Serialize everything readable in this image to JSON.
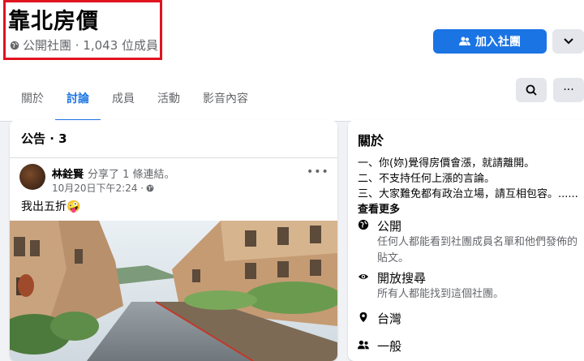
{
  "group": {
    "title": "靠北房價",
    "meta": "公開社團 · 1,043 位成員",
    "join_label": "加入社團",
    "accent_color": "#1b74e4",
    "highlight_color": "#e0131f"
  },
  "tabs": [
    {
      "label": "關於"
    },
    {
      "label": "討論"
    },
    {
      "label": "成員"
    },
    {
      "label": "活動"
    },
    {
      "label": "影音內容"
    }
  ],
  "announcements": {
    "title": "公告 · 3",
    "post": {
      "author": "林銓賢",
      "action": "分享了 1 條連結。",
      "time": "10月20日下午2:24 ·",
      "text": "我出五折🤪"
    }
  },
  "about": {
    "title": "關於",
    "description": "一、你(妳)覺得房價會漲，就請離開。\n二、不支持任何上漲的言論。\n三、大家難免都有政治立場，請互相包容。......",
    "see_more": "查看更多",
    "items": [
      {
        "icon": "globe-icon",
        "label": "公開",
        "sub": "任何人都能看到社團成員名單和他們發佈的貼文。"
      },
      {
        "icon": "eye-icon",
        "label": "開放搜尋",
        "sub": "所有人都能找到這個社團。"
      },
      {
        "icon": "location-pin-icon",
        "label": "台灣",
        "sub": ""
      },
      {
        "icon": "people-icon",
        "label": "一般",
        "sub": ""
      }
    ]
  }
}
